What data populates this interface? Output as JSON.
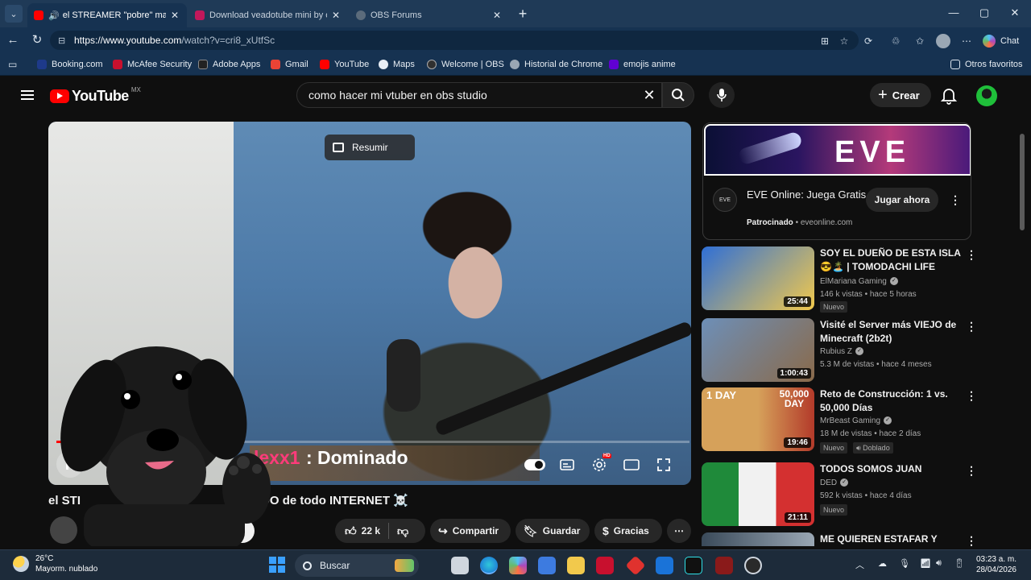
{
  "browser": {
    "tabs": [
      {
        "title": "el STREAMER \"pobre\" mas HA",
        "active": true,
        "favicon_color": "#ff0000"
      },
      {
        "title": "Download veadotube mini by olm",
        "active": false,
        "favicon_color": "#c2185b"
      },
      {
        "title": "OBS Forums",
        "active": false,
        "favicon_color": "#5b6b7b"
      }
    ],
    "url_host": "https://www.youtube.com",
    "url_path": "/watch?v=cri8_xUtfSc",
    "chat_label": "Chat",
    "bookmarks": [
      {
        "label": "Booking.com",
        "icon": "booking-icon",
        "color": "#1e3a8a"
      },
      {
        "label": "McAfee Security",
        "icon": "mcafee-icon",
        "color": "#c8102e"
      },
      {
        "label": "Adobe Apps",
        "icon": "adobe-icon",
        "color": "#222222"
      },
      {
        "label": "Gmail",
        "icon": "gmail-icon",
        "color": "#ea4335"
      },
      {
        "label": "YouTube",
        "icon": "youtube-icon",
        "color": "#ff0000"
      },
      {
        "label": "Maps",
        "icon": "maps-icon",
        "color": "#e8eef5"
      },
      {
        "label": "Welcome | OBS",
        "icon": "obs-icon",
        "color": "#303030"
      },
      {
        "label": "Historial de Chrome",
        "icon": "globe-icon",
        "color": "#9aa7b4"
      },
      {
        "label": "emojis anime",
        "icon": "yahoo-icon",
        "color": "#6001d2"
      }
    ],
    "other_favorites": "Otros favoritos"
  },
  "youtube": {
    "logo_text": "YouTube",
    "country_code": "MX",
    "search_query": "como hacer mi vtuber en obs studio",
    "create_label": "Crear",
    "player": {
      "summary_label": "Resumir",
      "caption_user": "lexx1",
      "caption_text": ": Dominado",
      "progress": 0.03,
      "hd_badge": "HD"
    },
    "video_title_left": "el STI",
    "video_title_right": "JREADO de todo INTERNET ☠️",
    "subscribe_label": "e",
    "like_count": "22 k",
    "share_label": "Compartir",
    "save_label": "Guardar",
    "thanks_label": "Gracias",
    "ad": {
      "title": "EVE Online: Juega Gratis",
      "sponsored": "Patrocinado",
      "domain": "eveonline.com",
      "cta": "Jugar ahora",
      "banner_text": "EVE",
      "icon_text": "EVE"
    },
    "recommendations": [
      {
        "title": "SOY EL DUEÑO DE ESTA ISLA 😎🏝️ | TOMODACHI LIFE",
        "channel": "ElMariana Gaming",
        "meta": "146 k vistas • hace 5 horas",
        "duration": "25:44",
        "badges": [
          "Nuevo"
        ],
        "thumb": [
          "#2f6fd6",
          "#f2c94c"
        ]
      },
      {
        "title": "Visité el Server más VIEJO de Minecraft (2b2t)",
        "channel": "Rubius Z",
        "meta": "5.3 M de vistas • hace 4 meses",
        "duration": "1:00:43",
        "badges": [],
        "thumb": [
          "#6d8fb8",
          "#8a6a4a"
        ]
      },
      {
        "title": "Reto de Construcción: 1 vs. 50,000 Días",
        "channel": "MrBeast Gaming",
        "meta": "18 M de vistas • hace 2 días",
        "duration": "19:46",
        "badges": [
          "Nuevo",
          "Doblado"
        ],
        "thumb": [
          "#d6a15a",
          "#b33a2a"
        ],
        "thumb_text_left": "1 DAY",
        "thumb_text_right": "50,000 DAY"
      },
      {
        "title": "TODOS SOMOS JUAN",
        "channel": "DED",
        "meta": "592 k vistas • hace 4 días",
        "duration": "21:11",
        "badges": [
          "Nuevo"
        ],
        "thumb": [
          "#1f8a3a",
          "#d43030"
        ]
      },
      {
        "title": "ME QUIEREN ESTAFAR Y",
        "channel": "",
        "meta": "",
        "duration": "",
        "badges": [],
        "thumb": [
          "#3a4a5a",
          "#9aa7b4"
        ]
      }
    ]
  },
  "taskbar": {
    "temperature": "26°C",
    "weather": "Mayorm. nublado",
    "search_placeholder": "Buscar",
    "time": "03:23 a. m.",
    "date": "28/04/2026"
  }
}
